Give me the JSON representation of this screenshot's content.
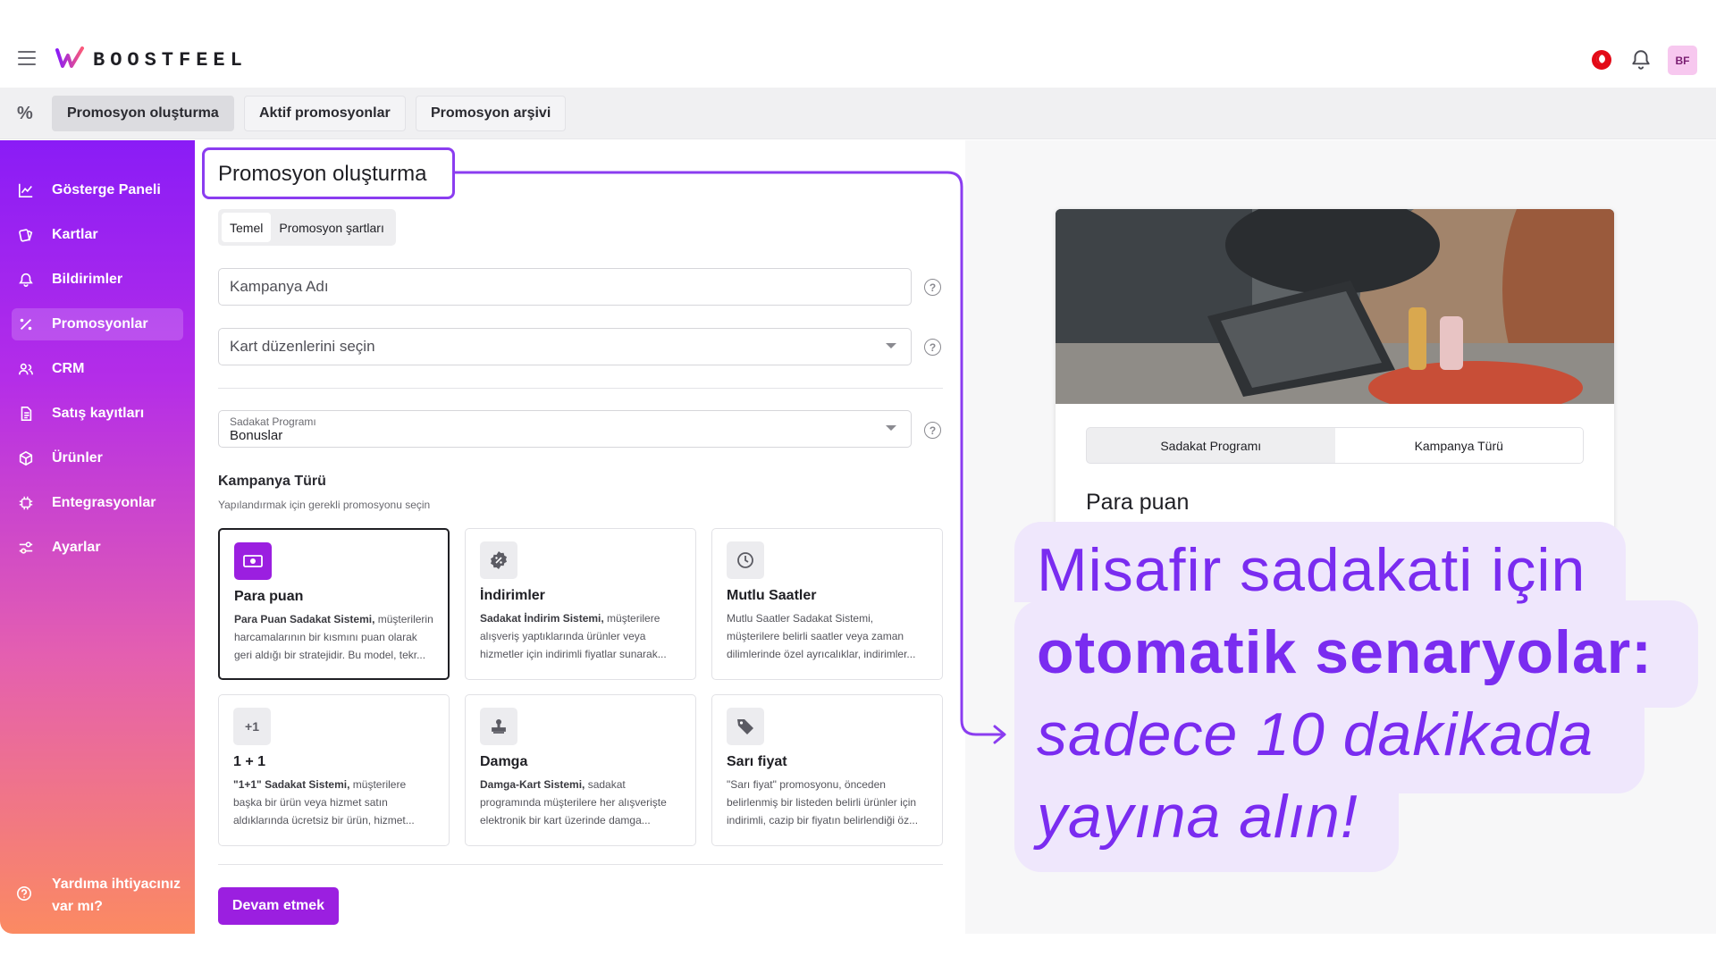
{
  "header": {
    "logo_text": "BOOSTFEEL",
    "avatar_initials": "BF",
    "icons": [
      "menu-icon",
      "turkish-flag-icon",
      "bell-icon"
    ]
  },
  "subnav": {
    "icon": "percent-icon",
    "tabs": [
      {
        "label": "Promosyon oluşturma",
        "active": true
      },
      {
        "label": "Aktif promosyonlar",
        "active": false
      },
      {
        "label": "Promosyon arşivi",
        "active": false
      }
    ]
  },
  "sidebar": {
    "items": [
      {
        "label": "Gösterge Paneli",
        "icon": "chart-line-icon"
      },
      {
        "label": "Kartlar",
        "icon": "cards-icon"
      },
      {
        "label": "Bildirimler",
        "icon": "bell-icon"
      },
      {
        "label": "Promosyonlar",
        "icon": "percent-icon",
        "active": true
      },
      {
        "label": "CRM",
        "icon": "users-icon"
      },
      {
        "label": "Satış kayıtları",
        "icon": "document-icon"
      },
      {
        "label": "Ürünler",
        "icon": "box-icon"
      },
      {
        "label": "Entegrasyonlar",
        "icon": "integration-icon"
      },
      {
        "label": "Ayarlar",
        "icon": "sliders-icon"
      }
    ],
    "help_label": "Yardıma ihtiyacınız var mı?"
  },
  "main": {
    "title": "Promosyon oluşturma",
    "tabs": [
      {
        "label": "Temel",
        "active": true
      },
      {
        "label": "Promosyon şartları",
        "active": false
      }
    ],
    "campaign_name_placeholder": "Kampanya Adı",
    "card_layouts_placeholder": "Kart düzenlerini seçin",
    "loyalty_program_label": "Sadakat Programı",
    "loyalty_program_value": "Bonuslar",
    "campaign_type_title": "Kampanya Türü",
    "campaign_type_subtitle": "Yapılandırmak için gerekli promosyonu seçin",
    "cards": [
      {
        "title": "Para puan",
        "bold": "Para Puan Sadakat Sistemi,",
        "text": " müşterilerin harcamalarının bir kısmını puan olarak geri aldığı bir stratejidir. Bu model, tekr...",
        "icon": "money-icon",
        "selected": true
      },
      {
        "title": "İndirimler",
        "bold": "Sadakat İndirim Sistemi,",
        "text": " müşterilere alışveriş yaptıklarında ürünler veya hizmetler için indirimli fiyatlar sunarak...",
        "icon": "discount-badge-icon",
        "selected": false
      },
      {
        "title": "Mutlu Saatler",
        "bold": "",
        "text": "Mutlu Saatler Sadakat Sistemi, müşterilere belirli saatler veya zaman dilimlerinde özel ayrıcalıklar, indirimler...",
        "icon": "clock-icon",
        "selected": false
      },
      {
        "title": "1 + 1",
        "bold": "\"1+1\" Sadakat Sistemi,",
        "text": " müşterilere başka bir ürün veya hizmet satın aldıklarında ücretsiz bir ürün, hizmet...",
        "icon": "plus-one-icon",
        "icon_text": "+1",
        "selected": false
      },
      {
        "title": "Damga",
        "bold": "Damga-Kart Sistemi,",
        "text": " sadakat programında müşterilere her alışverişte elektronik bir kart üzerinde damga...",
        "icon": "stamp-icon",
        "selected": false
      },
      {
        "title": "Sarı fiyat",
        "bold": "",
        "text": "\"Sarı fiyat\" promosyonu, önceden belirlenmiş bir listeden belirli ürünler için indirimli, cazip bir fiyatın belirlendiği öz...",
        "icon": "tag-icon",
        "selected": false
      }
    ],
    "continue_button": "Devam etmek"
  },
  "preview": {
    "tabs": [
      {
        "label": "Sadakat Programı",
        "active": false
      },
      {
        "label": "Kampanya Türü",
        "active": true
      }
    ],
    "title": "Para puan"
  },
  "callout": {
    "line1": "Misafir sadakati için",
    "line2": "otomatik senaryolar:",
    "line3": "sadece 10 dakikada",
    "line4": "yayına alın!"
  },
  "colors": {
    "accent": "#9b1fe0",
    "callout_text": "#7a2cf0",
    "callout_bg": "#efe7fc"
  }
}
